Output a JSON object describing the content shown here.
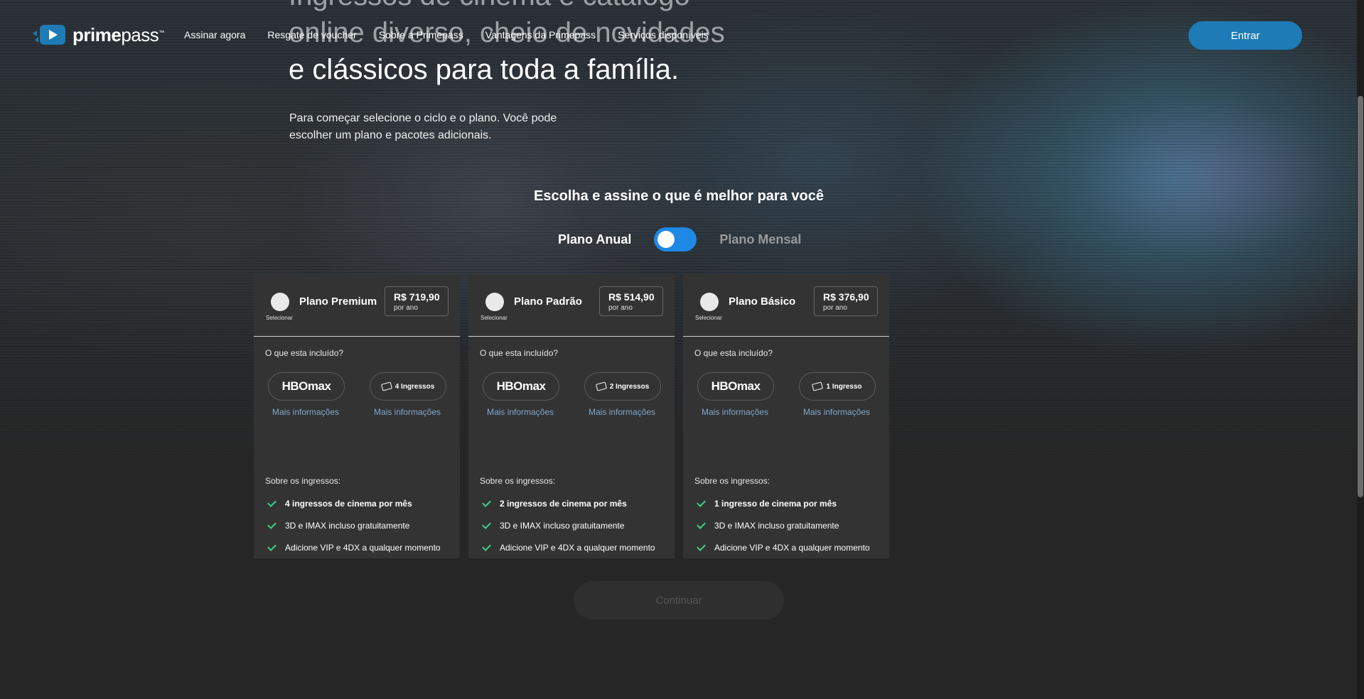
{
  "brand": {
    "name_bold": "prime",
    "name_light": "pass"
  },
  "nav": {
    "items": [
      "Assinar agora",
      "Resgate de voucher",
      "Sobre a Primepass",
      "Vantagens da Primepass",
      "Serviços disponíveis"
    ],
    "login_label": "Entrar"
  },
  "hero": {
    "title_line1": "Ingressos de cinema e catálogo",
    "title_line2": "online diverso, cheio de novidades",
    "title_line3": "e clássicos para toda a família.",
    "subtitle": "Para começar selecione o ciclo e o plano. Você pode escolher um plano e pacotes adicionais."
  },
  "plans_section": {
    "heading": "Escolha e assine o que é melhor para você",
    "toggle": {
      "annual_label": "Plano Anual",
      "monthly_label": "Plano Mensal",
      "selected": "annual"
    }
  },
  "plans": [
    {
      "select_label": "Selecionar",
      "name": "Plano Premium",
      "price": "R$ 719,90",
      "period": "por ano",
      "included_label": "O que esta incluído?",
      "hbo_label": "HBOmax",
      "tickets_label": "4 Ingressos",
      "more_info": "Mais informações",
      "about_label": "Sobre os ingressos:",
      "features": [
        "4 ingressos de cinema por mês",
        "3D e IMAX incluso gratuitamente",
        "Adicione VIP e 4DX a qualquer momento"
      ]
    },
    {
      "select_label": "Selecionar",
      "name": "Plano Padrão",
      "price": "R$ 514,90",
      "period": "por ano",
      "included_label": "O que esta incluído?",
      "hbo_label": "HBOmax",
      "tickets_label": "2 Ingressos",
      "more_info": "Mais informações",
      "about_label": "Sobre os ingressos:",
      "features": [
        "2 ingressos de cinema por mês",
        "3D e IMAX incluso gratuitamente",
        "Adicione VIP e 4DX a qualquer momento"
      ]
    },
    {
      "select_label": "Selecionar",
      "name": "Plano Básico",
      "price": "R$ 376,90",
      "period": "por ano",
      "included_label": "O que esta incluído?",
      "hbo_label": "HBOmax",
      "tickets_label": "1 Ingresso",
      "more_info": "Mais informações",
      "about_label": "Sobre os ingressos:",
      "features": [
        "1 ingresso de cinema por mês",
        "3D e IMAX incluso gratuitamente",
        "Adicione VIP e 4DX a qualquer momento"
      ]
    }
  ],
  "continue_label": "Continuar",
  "colors": {
    "accent": "#1e7bb6",
    "toggle": "#1e88e5",
    "check": "#3ecf8e",
    "link": "#7fa8cc",
    "card_bg": "#333333",
    "page_bg": "#262626"
  }
}
